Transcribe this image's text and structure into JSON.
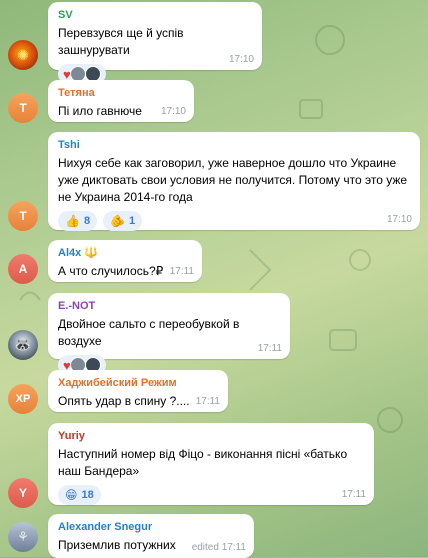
{
  "colors": {
    "accent": "#3a7bd5",
    "sv_name": "#2e9f58",
    "tetyana_name": "#d9732e",
    "tshi_name": "#2a7ec7",
    "al4x_name": "#2a7ec7",
    "enot_name": "#8e44ad",
    "xp_name": "#d9732e",
    "yuriy_name": "#c0392b",
    "alexander_name": "#2a7ec7"
  },
  "messages": [
    {
      "author": "SV",
      "text": "Перевзувся ще й успів зашнурувати",
      "time": "17:10",
      "reactions": [
        "heart-icon"
      ]
    },
    {
      "author": "Тетяна",
      "avatar_letter": "Т",
      "text": "Пі  ило гавнюче",
      "time": "17:10"
    },
    {
      "author": "Tshi",
      "avatar_letter": "T",
      "text": "Нихуя себе как заговорил, уже наверное дошло что Украине уже диктовать свои условия не получится. Потому что это уже не Украина 2014-го года",
      "time": "17:10",
      "reactions": [
        {
          "icon": "thumbs-up-icon",
          "count": "8"
        },
        {
          "icon": "pointing-hand-icon",
          "count": "1"
        }
      ]
    },
    {
      "author": "Al4x",
      "avatar_letter": "A",
      "text": "А что случилось?₽",
      "time": "17:11"
    },
    {
      "author": "E.-NOT",
      "text": "Двойное сальто с переобувкой в воздухе",
      "time": "17:11",
      "reactions": [
        "heart-icon"
      ]
    },
    {
      "author": "Хаджибейский Режим",
      "avatar_letter": "XP",
      "text": "Опять удар в спину ?....",
      "time": "17:11"
    },
    {
      "author": "Yuriy",
      "avatar_letter": "Y",
      "text": "Наступний номер від Фіцо - виконання пісні «батько наш Бандера»",
      "time": "17:11",
      "reactions": [
        {
          "icon": "grin-icon",
          "count": "18"
        }
      ]
    },
    {
      "author": "Alexander Snegur",
      "text": "Приземлив потужних",
      "time": "edited 17:11"
    }
  ]
}
